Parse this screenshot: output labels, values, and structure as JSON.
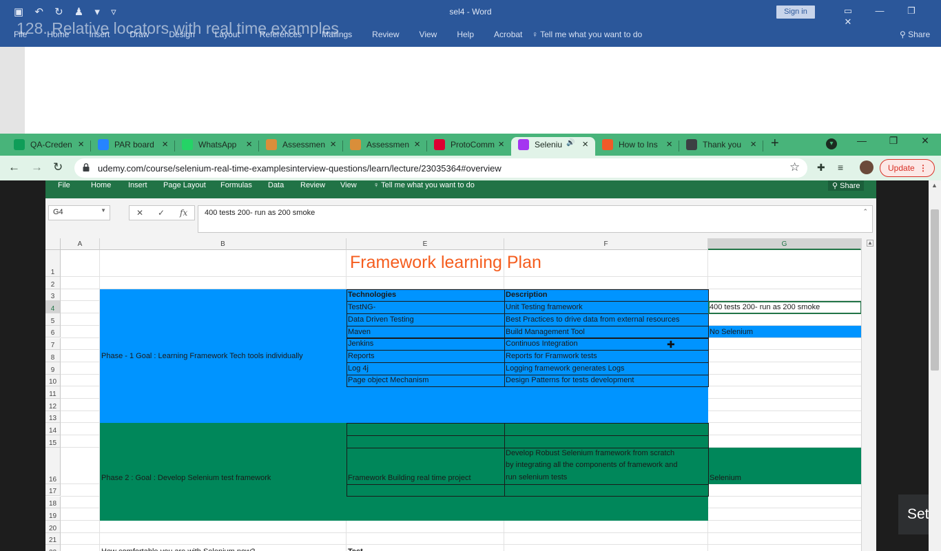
{
  "word": {
    "title": "sel4 - Word",
    "sign_in": "Sign in",
    "menu": [
      "File",
      "Home",
      "Insert",
      "Draw",
      "Design",
      "Layout",
      "References",
      "Mailings",
      "Review",
      "View",
      "Help",
      "Acrobat"
    ],
    "tell_me": "Tell me what you want to do",
    "share": "Share"
  },
  "lecture_title": "128. Relative locators with real time examples",
  "browser": {
    "tabs": [
      {
        "label": "QA-Creden",
        "icon": "sheets-icon",
        "color": "#0f9d58"
      },
      {
        "label": "PAR board",
        "icon": "jira-icon",
        "color": "#2684ff"
      },
      {
        "label": "WhatsApp",
        "icon": "whatsapp-icon",
        "color": "#25d366"
      },
      {
        "label": "Assessmen",
        "icon": "meettrac-icon",
        "color": "#d98e3a"
      },
      {
        "label": "Assessmen",
        "icon": "meettrac-icon",
        "color": "#d98e3a"
      },
      {
        "label": "ProtoComm",
        "icon": "angular-icon",
        "color": "#dd0031"
      },
      {
        "label": "Seleniu",
        "icon": "udemy-icon",
        "color": "#a435f0"
      },
      {
        "label": "How to Ins",
        "icon": "blog-icon",
        "color": "#f05a28"
      },
      {
        "label": "Thank you",
        "icon": "globe-icon",
        "color": "#3c4043"
      }
    ],
    "url": "udemy.com/course/selenium-real-time-examplesinterview-questions/learn/lecture/23035364#overview",
    "update_label": "Update"
  },
  "excel": {
    "ribbon": [
      "File",
      "Home",
      "Insert",
      "Page Layout",
      "Formulas",
      "Data",
      "Review",
      "View"
    ],
    "tell_me": "Tell me what you want to do",
    "share": "Share",
    "name_box": "G4",
    "formula": "400 tests 200- run as 200 smoke",
    "columns": [
      "A",
      "B",
      "E",
      "F",
      "G"
    ],
    "rows": [
      "1",
      "2",
      "3",
      "4",
      "5",
      "6",
      "7",
      "8",
      "9",
      "10",
      "11",
      "12",
      "13",
      "14",
      "15",
      "16",
      "17",
      "18",
      "19",
      "20",
      "21",
      "22"
    ],
    "sheet_title": "Framework learning Plan",
    "phase1": {
      "label": "Phase - 1    Goal :  Learning Framework Tech tools individually",
      "col_tech": "Technologies",
      "col_desc": "Description",
      "items": [
        {
          "tech": "TestNG-",
          "desc": "Unit Testing framework"
        },
        {
          "tech": "Data Driven Testing",
          "desc": "Best Practices to drive data from external resources"
        },
        {
          "tech": "Maven",
          "desc": "Build Management Tool"
        },
        {
          "tech": "Jenkins",
          "desc": "Continuos Integration"
        },
        {
          "tech": "Reports",
          "desc": "Reports for Framwork tests"
        },
        {
          "tech": "Log 4j",
          "desc": "Logging framework generates Logs"
        },
        {
          "tech": "Page object Mechanism",
          "desc": "Design Patterns for tests development"
        }
      ],
      "g4": "400 tests 200- run as 200 smoke",
      "g6": "No Selenium"
    },
    "phase2": {
      "label": "Phase 2 : Goal : Develop Selenium test framework",
      "tech": "Framework Building real time project",
      "desc_lines": [
        "Develop Robust Selenium framework from scratch",
        "by integrating all the components of framework and",
        "run  selenium tests"
      ],
      "g16": "Selenium"
    },
    "row22_b": "How comfortable you are with Selenium now?",
    "row22_e": "Test"
  },
  "overlay_label": "Set",
  "colors": {
    "word_blue": "#2b579a",
    "chrome_green": "#48b47a",
    "excel_green": "#217346",
    "phase1_blue": "#0094ff",
    "phase2_green": "#00875a",
    "title_orange": "#f55d1e"
  }
}
